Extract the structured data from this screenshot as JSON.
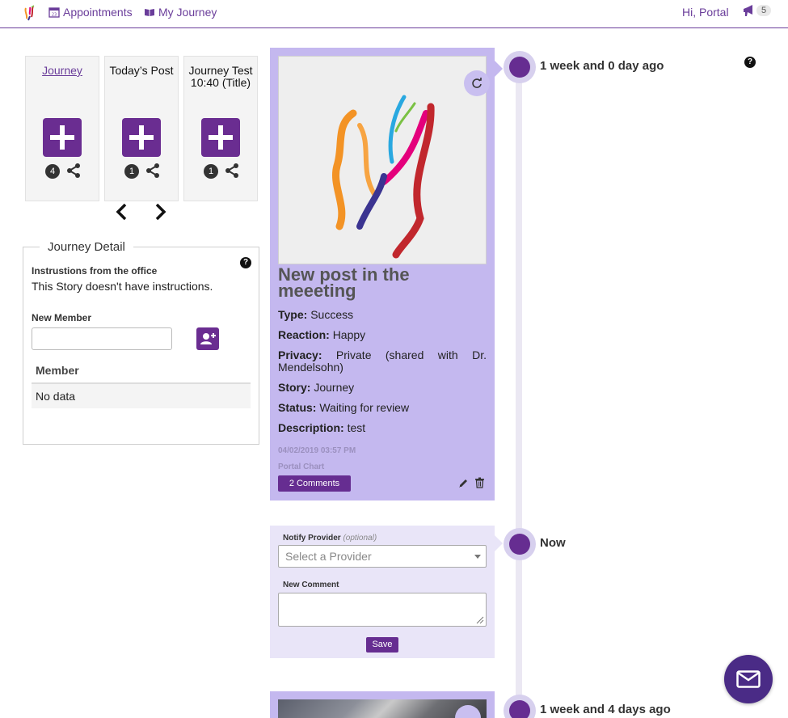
{
  "nav": {
    "appointments": "Appointments",
    "my_journey": "My Journey",
    "greeting": "Hi, Portal",
    "notification_count": "5"
  },
  "stories": [
    {
      "title": "Journey",
      "count": "4"
    },
    {
      "title": "Today’s Post",
      "count": "1"
    },
    {
      "title": "Journey Test 10:40 (Title)",
      "count": "1"
    }
  ],
  "journey_detail": {
    "legend": "Journey Detail",
    "instructions_label": "Instrustions from the office",
    "instructions_text": "This Story doesn't have instructions.",
    "new_member_label": "New Member",
    "member_value": "",
    "table_header": "Member",
    "table_empty": "No data"
  },
  "timeline": [
    {
      "label": "1 week and 0 day ago"
    },
    {
      "label": "Now"
    },
    {
      "label": "1 week and 4 days ago"
    }
  ],
  "post": {
    "title": "New post in the meeeting",
    "type_label": "Type:",
    "type": "Success",
    "reaction_label": "Reaction:",
    "reaction": "Happy",
    "privacy_label": "Privacy:",
    "privacy": "Private (shared with Dr. Mendelsohn)",
    "story_label": "Story:",
    "story": "Journey",
    "status_label": "Status:",
    "status": "Waiting for review",
    "description_label": "Description:",
    "description": "test",
    "date": "04/02/2019 03:57 PM",
    "chart": "Portal Chart",
    "comments_button": "2 Comments"
  },
  "comment_form": {
    "notify_label": "Notify Provider",
    "notify_optional": "(optional)",
    "provider_placeholder": "Select a Provider",
    "new_comment_label": "New Comment",
    "comment_value": "",
    "save": "Save"
  },
  "colors": {
    "brand_purple": "#662d91",
    "card_lavender": "#c4b8ef",
    "comment_card": "#e9e5f8"
  },
  "icons": {
    "help": "?"
  }
}
